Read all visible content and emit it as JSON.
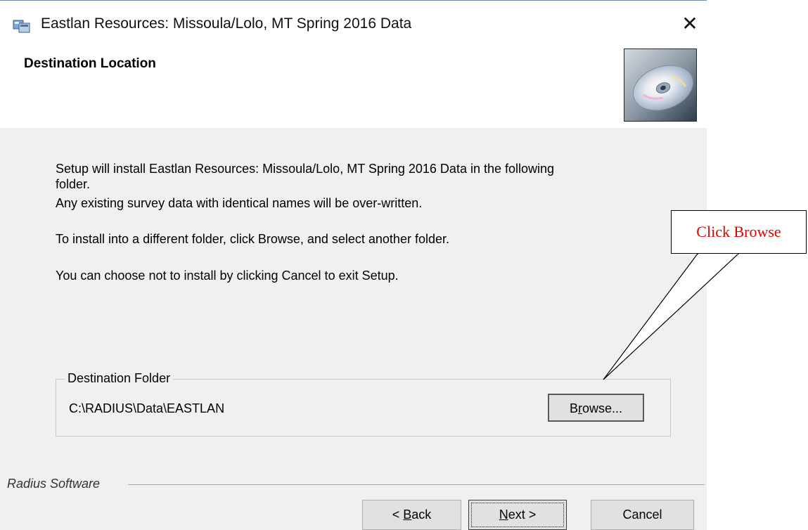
{
  "window": {
    "title": "Eastlan Resources: Missoula/Lolo, MT Spring 2016 Data",
    "close_glyph": "✕"
  },
  "header": {
    "title": "Destination Location",
    "icon": "cd-disc-icon"
  },
  "body": {
    "line1": "Setup will install Eastlan Resources: Missoula/Lolo, MT Spring 2016 Data in the following",
    "line2": "folder.",
    "line3": "Any existing survey data with identical names will be over-written.",
    "line4": "To install into a different folder, click Browse, and select another folder.",
    "line5": "You can choose not to install  by clicking Cancel to exit Setup."
  },
  "destination": {
    "group_label": "Destination Folder",
    "path": "C:\\RADIUS\\Data\\EASTLAN",
    "browse_pre": "B",
    "browse_key": "r",
    "browse_post": "owse..."
  },
  "footer": {
    "brand": "Radius Software",
    "back_pre": "< ",
    "back_key": "B",
    "back_post": "ack",
    "next_key": "N",
    "next_post": "ext >",
    "cancel_label": "Cancel"
  },
  "callout": {
    "text": "Click Browse",
    "color": "#e00000"
  }
}
